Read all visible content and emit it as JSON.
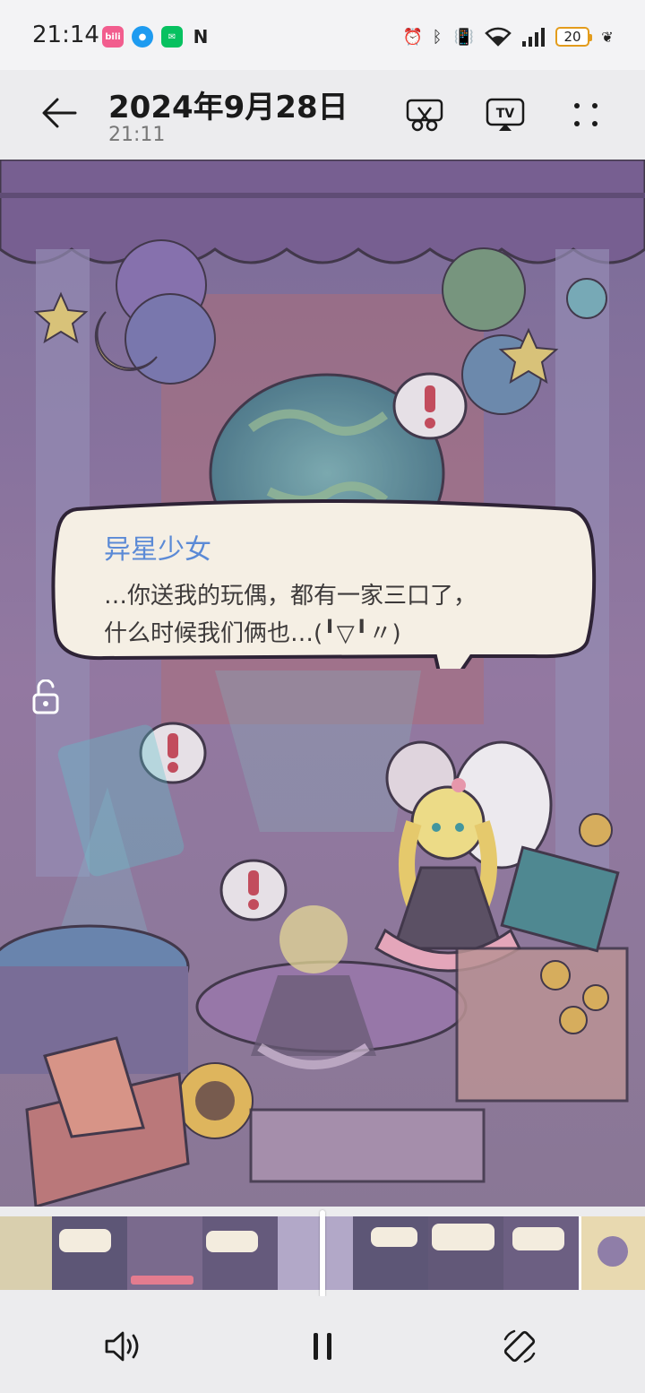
{
  "status_bar": {
    "time": "21:14",
    "battery": "20",
    "app_icons": [
      "bilibili-icon",
      "message-icon",
      "wechat-icon",
      "nfc-icon"
    ],
    "system_icons": [
      "alarm-icon",
      "bluetooth-icon",
      "vibrate-icon",
      "wifi-icon",
      "signal-icon",
      "battery-icon",
      "leaf-icon"
    ]
  },
  "header": {
    "title": "2024年9月28日",
    "subtitle": "21:11",
    "actions": [
      "edit-clip-icon",
      "tv-cast-icon",
      "more-icon"
    ],
    "tv_label": "TV"
  },
  "video": {
    "dialog": {
      "speaker": "异星少女",
      "line1": "…你送我的玩偶，都有一家三口了，",
      "line2": "什么时候我们俩也…(╹▽╹〃)"
    }
  },
  "filmstrip": {
    "frame_count": 9,
    "progress": 0.5
  },
  "controls": [
    "volume-icon",
    "pause-icon",
    "rotate-icon"
  ],
  "colors": {
    "accent_battery": "#e39c1c",
    "speaker_name": "#5b8ad6",
    "bubble_fill": "#f5efe4"
  }
}
